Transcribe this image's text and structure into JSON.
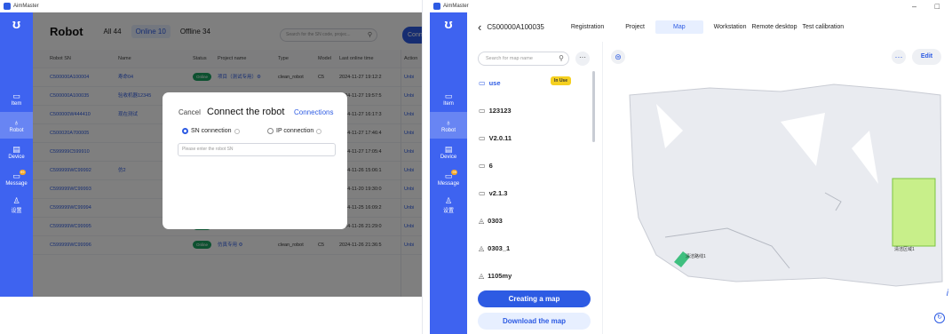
{
  "left": {
    "app_title": "AimMaster",
    "brand": "ʊ",
    "sidebar": [
      {
        "label": "Item",
        "icon": "▭"
      },
      {
        "label": "Robot",
        "icon": "♁"
      },
      {
        "label": "Device",
        "icon": "▤"
      },
      {
        "label": "Message",
        "icon": "▭",
        "badge": "99"
      },
      {
        "label": "设置",
        "icon": "♙"
      }
    ],
    "title": "Robot",
    "tabs": [
      {
        "label": "All 44"
      },
      {
        "label": "Online 10"
      },
      {
        "label": "Offline 34"
      }
    ],
    "search_placeholder": "Search for the SN code, projec...",
    "connect_button": "Connect",
    "columns": [
      "Robot SN",
      "Name",
      "Status",
      "Project name",
      "Type",
      "Model",
      "Last online time",
      "Action"
    ],
    "rows": [
      {
        "sn": "C500000A100004",
        "name": "寿命04",
        "status": "Online",
        "project": "项目（测试专用）⚙",
        "type": "clean_robot",
        "model": "C5",
        "time": "2024-11-27 19:12:2",
        "action": "Unbi"
      },
      {
        "sn": "C500000A100035",
        "name": "验收机器12345",
        "status": "",
        "project": "",
        "type": "",
        "model": "",
        "time": "2024-11-27 19:57:5",
        "action": "Unbi"
      },
      {
        "sn": "C500000W444410",
        "name": "现在测试",
        "status": "",
        "project": "",
        "type": "",
        "model": "",
        "time": "2024-11-27 16:17:3",
        "action": "Unbi"
      },
      {
        "sn": "C500020A700005",
        "name": "",
        "status": "",
        "project": "",
        "type": "",
        "model": "",
        "time": "2024-11-27 17:46:4",
        "action": "Unbi"
      },
      {
        "sn": "C599999C599910",
        "name": "",
        "status": "",
        "project": "",
        "type": "",
        "model": "",
        "time": "2024-11-27 17:05:4",
        "action": "Unbi"
      },
      {
        "sn": "C599999WC99992",
        "name": "仿2",
        "status": "",
        "project": "",
        "type": "",
        "model": "",
        "time": "2024-11-26 15:06:1",
        "action": "Unbi"
      },
      {
        "sn": "C599999WC99993",
        "name": "",
        "status": "",
        "project": "",
        "type": "",
        "model": "",
        "time": "2024-11-20 19:30:0",
        "action": "Unbi"
      },
      {
        "sn": "C599999WC99994",
        "name": "",
        "status": "Online",
        "project": "仿真专用 ⚙",
        "type": "clean_robot",
        "model": "C5",
        "time": "2024-11-25 16:09:2",
        "action": "Unbi"
      },
      {
        "sn": "C599999WC99995",
        "name": "",
        "status": "Online",
        "project": "仿真专用 ⚙",
        "type": "clean_robot",
        "model": "C5",
        "time": "2024-11-26 21:29:0",
        "action": "Unbi"
      },
      {
        "sn": "C599999WC99996",
        "name": "",
        "status": "Online",
        "project": "仿真专用 ⚙",
        "type": "clean_robot",
        "model": "C5",
        "time": "2024-11-26 21:36:5",
        "action": "Unbi"
      }
    ],
    "dialog": {
      "cancel": "Cancel",
      "title": "Connect the robot",
      "connections": "Connections",
      "option_sn": "SN connection",
      "option_ip": "IP connection",
      "input_placeholder": "Please enter the robot SN"
    }
  },
  "right": {
    "app_title": "AimMaster",
    "brand": "ʊ",
    "window_controls": [
      "–",
      "□"
    ],
    "sidebar": [
      {
        "label": "Item",
        "icon": "▭"
      },
      {
        "label": "Robot",
        "icon": "♁"
      },
      {
        "label": "Device",
        "icon": "▤"
      },
      {
        "label": "Message",
        "icon": "▭",
        "badge": "99"
      },
      {
        "label": "设置",
        "icon": "♙"
      }
    ],
    "back": "‹",
    "robot_sn": "C500000A100035",
    "tabs": [
      "Registration",
      "Project",
      "Map",
      "Workstation",
      "Remote desktop",
      "Test calibration"
    ],
    "map_search_placeholder": "Search for map name",
    "more": "···",
    "maps": [
      {
        "name": "use",
        "icon": "▭",
        "in_use": "In Use"
      },
      {
        "name": "123123",
        "icon": "▭"
      },
      {
        "name": "V2.0.11",
        "icon": "▭"
      },
      {
        "name": "6",
        "icon": "▭"
      },
      {
        "name": "v2.1.3",
        "icon": "▭"
      },
      {
        "name": "0303",
        "icon": "◬"
      },
      {
        "name": "0303_1",
        "icon": "◬"
      },
      {
        "name": "1105my",
        "icon": "◬"
      }
    ],
    "create_map": "Creating a map",
    "download_map": "Download the map",
    "edit": "Edit",
    "map_labels": {
      "zone_green": "清洁区域1",
      "path_label": "清洁路线1"
    },
    "info_glyph": "i",
    "refresh_glyph": "↻",
    "layers_glyph": "⊜",
    "accent": "#2d5be3",
    "sidebar_color": "#3e63f0"
  }
}
